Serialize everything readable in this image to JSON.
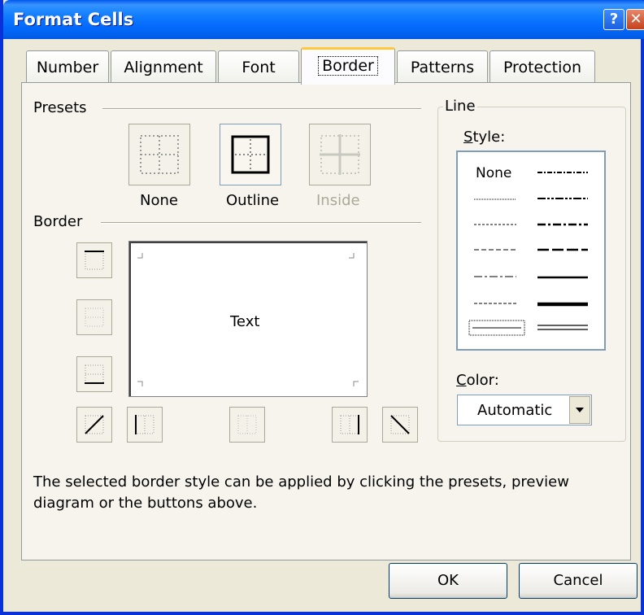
{
  "window": {
    "title": "Format Cells"
  },
  "titlebar": {
    "help_glyph": "?",
    "close_glyph": "✕"
  },
  "tabs": [
    {
      "label": "Number"
    },
    {
      "label": "Alignment"
    },
    {
      "label": "Font"
    },
    {
      "label": "Border",
      "active": true
    },
    {
      "label": "Patterns"
    },
    {
      "label": "Protection"
    }
  ],
  "presets": {
    "group_label": "Presets",
    "none_label": "None",
    "outline_label": "Outline",
    "inside_label": "Inside"
  },
  "border": {
    "group_label": "Border",
    "preview_text": "Text"
  },
  "line": {
    "group_label": "Line",
    "style_label": "Style:",
    "style_none": "None",
    "color_label": "Color:",
    "color_value": "Automatic"
  },
  "hint_line1": "The selected border style can be applied by clicking the presets, preview",
  "hint_line2": "diagram or the buttons above.",
  "buttons": {
    "ok": "OK",
    "cancel": "Cancel"
  },
  "colors": {
    "titlebar": "#0058EE",
    "face": "#ECE9D8",
    "active_tab_accent": "#FFC83C"
  }
}
